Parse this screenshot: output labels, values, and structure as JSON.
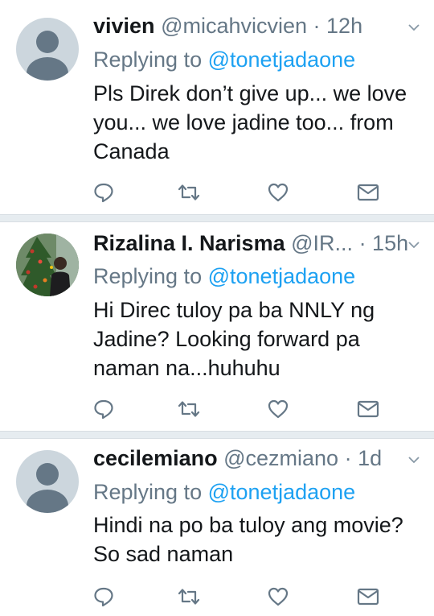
{
  "tweets": [
    {
      "name": "vivien",
      "handle": "@micahvicvien",
      "time": "· 12h",
      "replying_prefix": "Replying to",
      "replying_to": "@tonetjadaone",
      "lines": [
        "Pls Direk don’t give up... we love",
        "you... we love jadine too... from",
        "Canada"
      ]
    },
    {
      "name": "Rizalina I. Narisma",
      "handle": "@IR...",
      "time": "· 15h",
      "replying_prefix": "Replying to",
      "replying_to": "@tonetjadaone",
      "lines": [
        "Hi Direc tuloy pa ba NNLY ng",
        "Jadine? Looking forward pa",
        "naman na...huhuhu"
      ]
    },
    {
      "name": "cecilemiano",
      "handle": "@cezmiano",
      "time": "· 1d",
      "replying_prefix": "Replying to",
      "replying_to": "@tonetjadaone",
      "lines": [
        "Hindi na po ba tuloy ang movie?",
        "So sad naman"
      ]
    }
  ],
  "colors": {
    "text": "#14171a",
    "secondary": "#657786",
    "link": "#1da1f2",
    "divider": "#e6ecf0"
  },
  "icons": [
    "reply-icon",
    "retweet-icon",
    "like-icon",
    "dm-icon",
    "chevron-down-icon",
    "default-avatar-icon"
  ]
}
